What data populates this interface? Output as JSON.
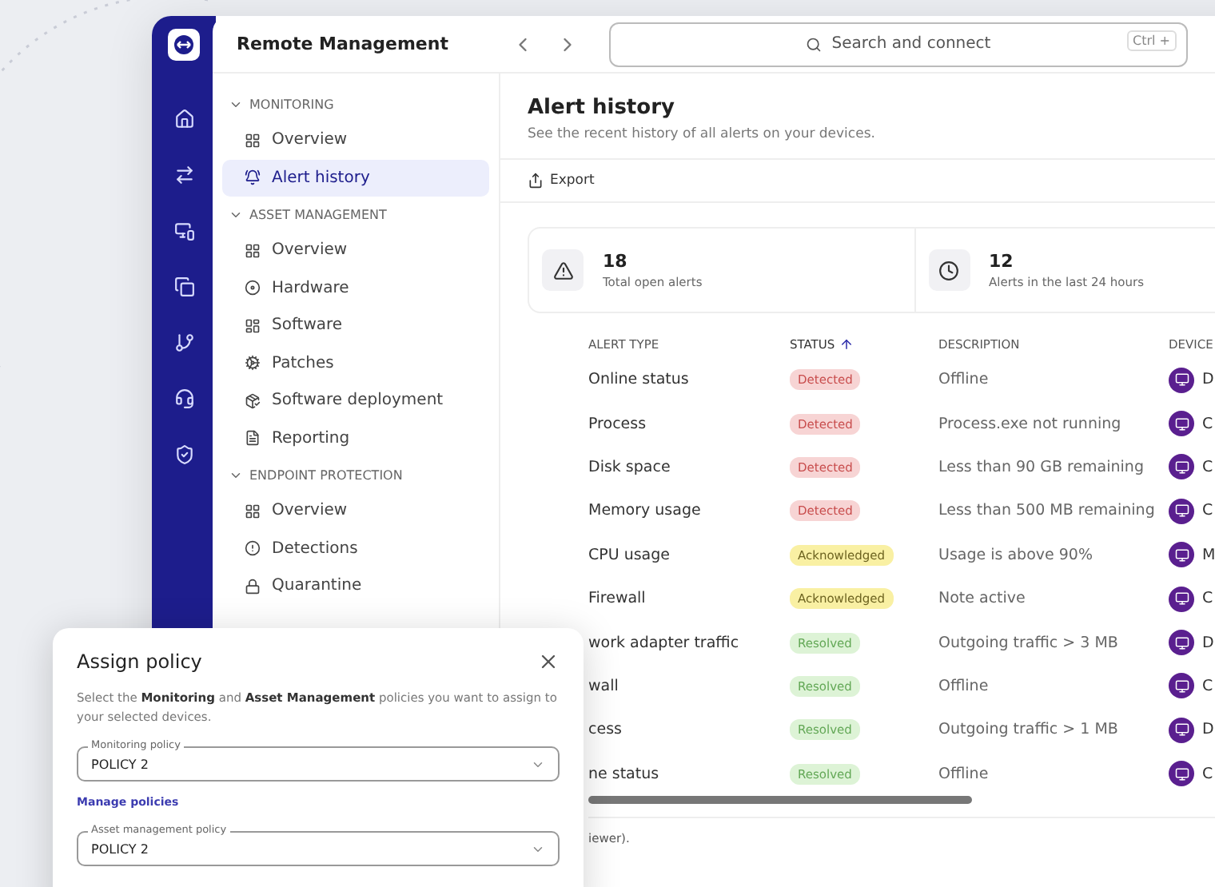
{
  "app": {
    "title": "Remote Management"
  },
  "search": {
    "placeholder": "Search and connect",
    "shortcut": "Ctrl +"
  },
  "sidebar": [
    {
      "label": "MONITORING",
      "expanded": true,
      "children": [
        {
          "label": "Overview",
          "selected": false
        },
        {
          "label": "Alert history",
          "selected": true
        }
      ]
    },
    {
      "label": "ASSET MANAGEMENT",
      "expanded": true,
      "children": [
        {
          "label": "Overview",
          "selected": false
        },
        {
          "label": "Hardware",
          "selected": false
        },
        {
          "label": "Software",
          "selected": false
        },
        {
          "label": "Patches",
          "selected": false
        },
        {
          "label": "Software deployment",
          "selected": false
        },
        {
          "label": "Reporting",
          "selected": false
        }
      ]
    },
    {
      "label": "ENDPOINT PROTECTION",
      "expanded": true,
      "children": [
        {
          "label": "Overview",
          "selected": false
        },
        {
          "label": "Detections",
          "selected": false
        },
        {
          "label": "Quarantine",
          "selected": false
        }
      ]
    }
  ],
  "page": {
    "title": "Alert history",
    "subtitle": "See the recent history of all alerts on your devices."
  },
  "toolbar": {
    "export": "Export"
  },
  "stats": [
    {
      "value": "18",
      "label": "Total open alerts"
    },
    {
      "value": "12",
      "label": "Alerts in the last 24 hours"
    }
  ],
  "table": {
    "columns": [
      {
        "label": "ALERT TYPE",
        "sorted": false
      },
      {
        "label": "STATUS",
        "sorted": true
      },
      {
        "label": "DESCRIPTION",
        "sorted": false
      },
      {
        "label": "DEVICE",
        "sorted": false
      }
    ],
    "rows": [
      {
        "type": "Online status",
        "status": "Detected",
        "kind": "detected",
        "description": "Offline",
        "device": "D"
      },
      {
        "type": "Process",
        "status": "Detected",
        "kind": "detected",
        "description": "Process.exe not running",
        "device": "C"
      },
      {
        "type": "Disk space",
        "status": "Detected",
        "kind": "detected",
        "description": "Less than 90 GB remaining",
        "device": "C"
      },
      {
        "type": "Memory usage",
        "status": "Detected",
        "kind": "detected",
        "description": "Less than 500 MB remaining",
        "device": "C"
      },
      {
        "type": "CPU usage",
        "status": "Acknowledged",
        "kind": "acknowledged",
        "description": "Usage is above 90%",
        "device": "M"
      },
      {
        "type": "Firewall",
        "status": "Acknowledged",
        "kind": "acknowledged",
        "description": "Note active",
        "device": "C"
      },
      {
        "type": "work adapter traffic",
        "status": "Resolved",
        "kind": "resolved",
        "description": "Outgoing traffic > 3 MB",
        "device": "D"
      },
      {
        "type": "wall",
        "status": "Resolved",
        "kind": "resolved",
        "description": "Offline",
        "device": "C"
      },
      {
        "type": "cess",
        "status": "Resolved",
        "kind": "resolved",
        "description": "Outgoing traffic > 1 MB",
        "device": "D"
      },
      {
        "type": "ne status",
        "status": "Resolved",
        "kind": "resolved",
        "description": "Offline",
        "device": "C"
      }
    ],
    "footer": "iewer)."
  },
  "dialog": {
    "title": "Assign policy",
    "description": "Select the **Monitoring** and **Asset Management** policies you want to assign to your selected devices.",
    "fields": [
      {
        "label": "Monitoring policy",
        "value": "POLICY 2"
      },
      {
        "label": "Asset management policy",
        "value": "POLICY 2"
      }
    ],
    "link": "Manage policies"
  }
}
